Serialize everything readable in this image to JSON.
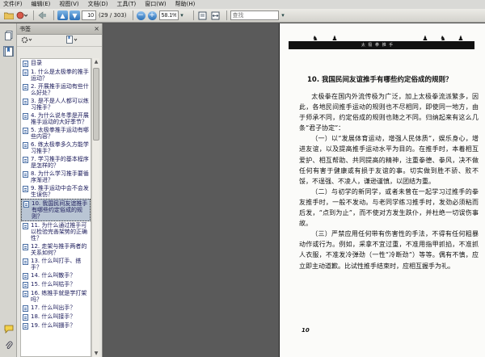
{
  "menu": [
    "文件(F)",
    "编辑(E)",
    "视图(V)",
    "文档(D)",
    "工具(T)",
    "窗口(W)",
    "帮助(H)"
  ],
  "toolbar": {
    "page_current": "10",
    "page_total": "(29 / 303)",
    "zoom": "58.1%",
    "search_placeholder": "查找"
  },
  "panel": {
    "title": "书签",
    "close": "×"
  },
  "bookmarks": [
    "目录",
    "1. 什么是太极拳的推手运动？",
    "2. 开展推手运动有些什么好处？",
    "3. 是不是人人都可以练习推手？",
    "4. 为什么说冬季是开展推手运动的大好季节？",
    "5. 太极拳推手运动有哪些内容？",
    "6. 练太极拳多久方能学习推手？",
    "7. 学习推手的基本程序是怎样的？",
    "8. 为什么学习推手要循序渐进？",
    "9. 推手运动中会不会发生误伤？",
    "10. 我国民间友谊推手有哪些约定俗成的规则？",
    "11. 为什么通过推手可以检验完善架势的正确性？",
    "12. 走架与推手两者的关系如何？",
    "13. 什么叫打手、搭手？",
    "14. 什么叫散手？",
    "15. 什么叫枯手？",
    "16. 练推手就是学打架吗？",
    "17. 什么叫出手？",
    "18. 什么叫接手？",
    "19. 什么叫掤手？"
  ],
  "selected_bookmark": 10,
  "page": {
    "band_caption": "太 极 拳 推 手",
    "question_title": "10. 我国民间友谊推手有哪些约定俗成的规则？",
    "paragraphs": [
      "太极拳在国内外流传极为广泛，加上太极拳流派繁多，因此，各地民间推手运动的规则也不尽相同，即使同一地方，由于师承不同，约定俗成的规则也随之不同。归纳起来有这么几条“君子协定”：",
      "（一）以“发展体育运动，增强人民体质”，娱乐身心，增进友谊，以及提高推手运动水平为目的。在推手时，本着相互爱护、相互帮助、共同提高的精神，注重拳德、拳风，决不做任何有害于健康或有损于友谊的事。切实做到胜不骄、败不馁，不逞强、不凌人，谦逊谨慎，以团结为重。",
      "（二）与初学的新同学，或者未曾在一起学习过推手的拳友推手时，一般不发动。与老同学练习推手时，发劲必须粘而后发，“点到为止”，而不使对方发生跌仆，并杜绝一切误伤事故。",
      "（三）严禁应用任何带有伤害性的手法，不得有任何粗暴动作或行为。例如，采拿不宜过重，不准用指甲抓掐，不准抓人衣服，不准发冷弹劲（一性“冷断劲”）等等。偶有不慎，应立即主动道歉。比试性推手结束时，应相互握手为礼。"
    ],
    "page_number": "10"
  }
}
